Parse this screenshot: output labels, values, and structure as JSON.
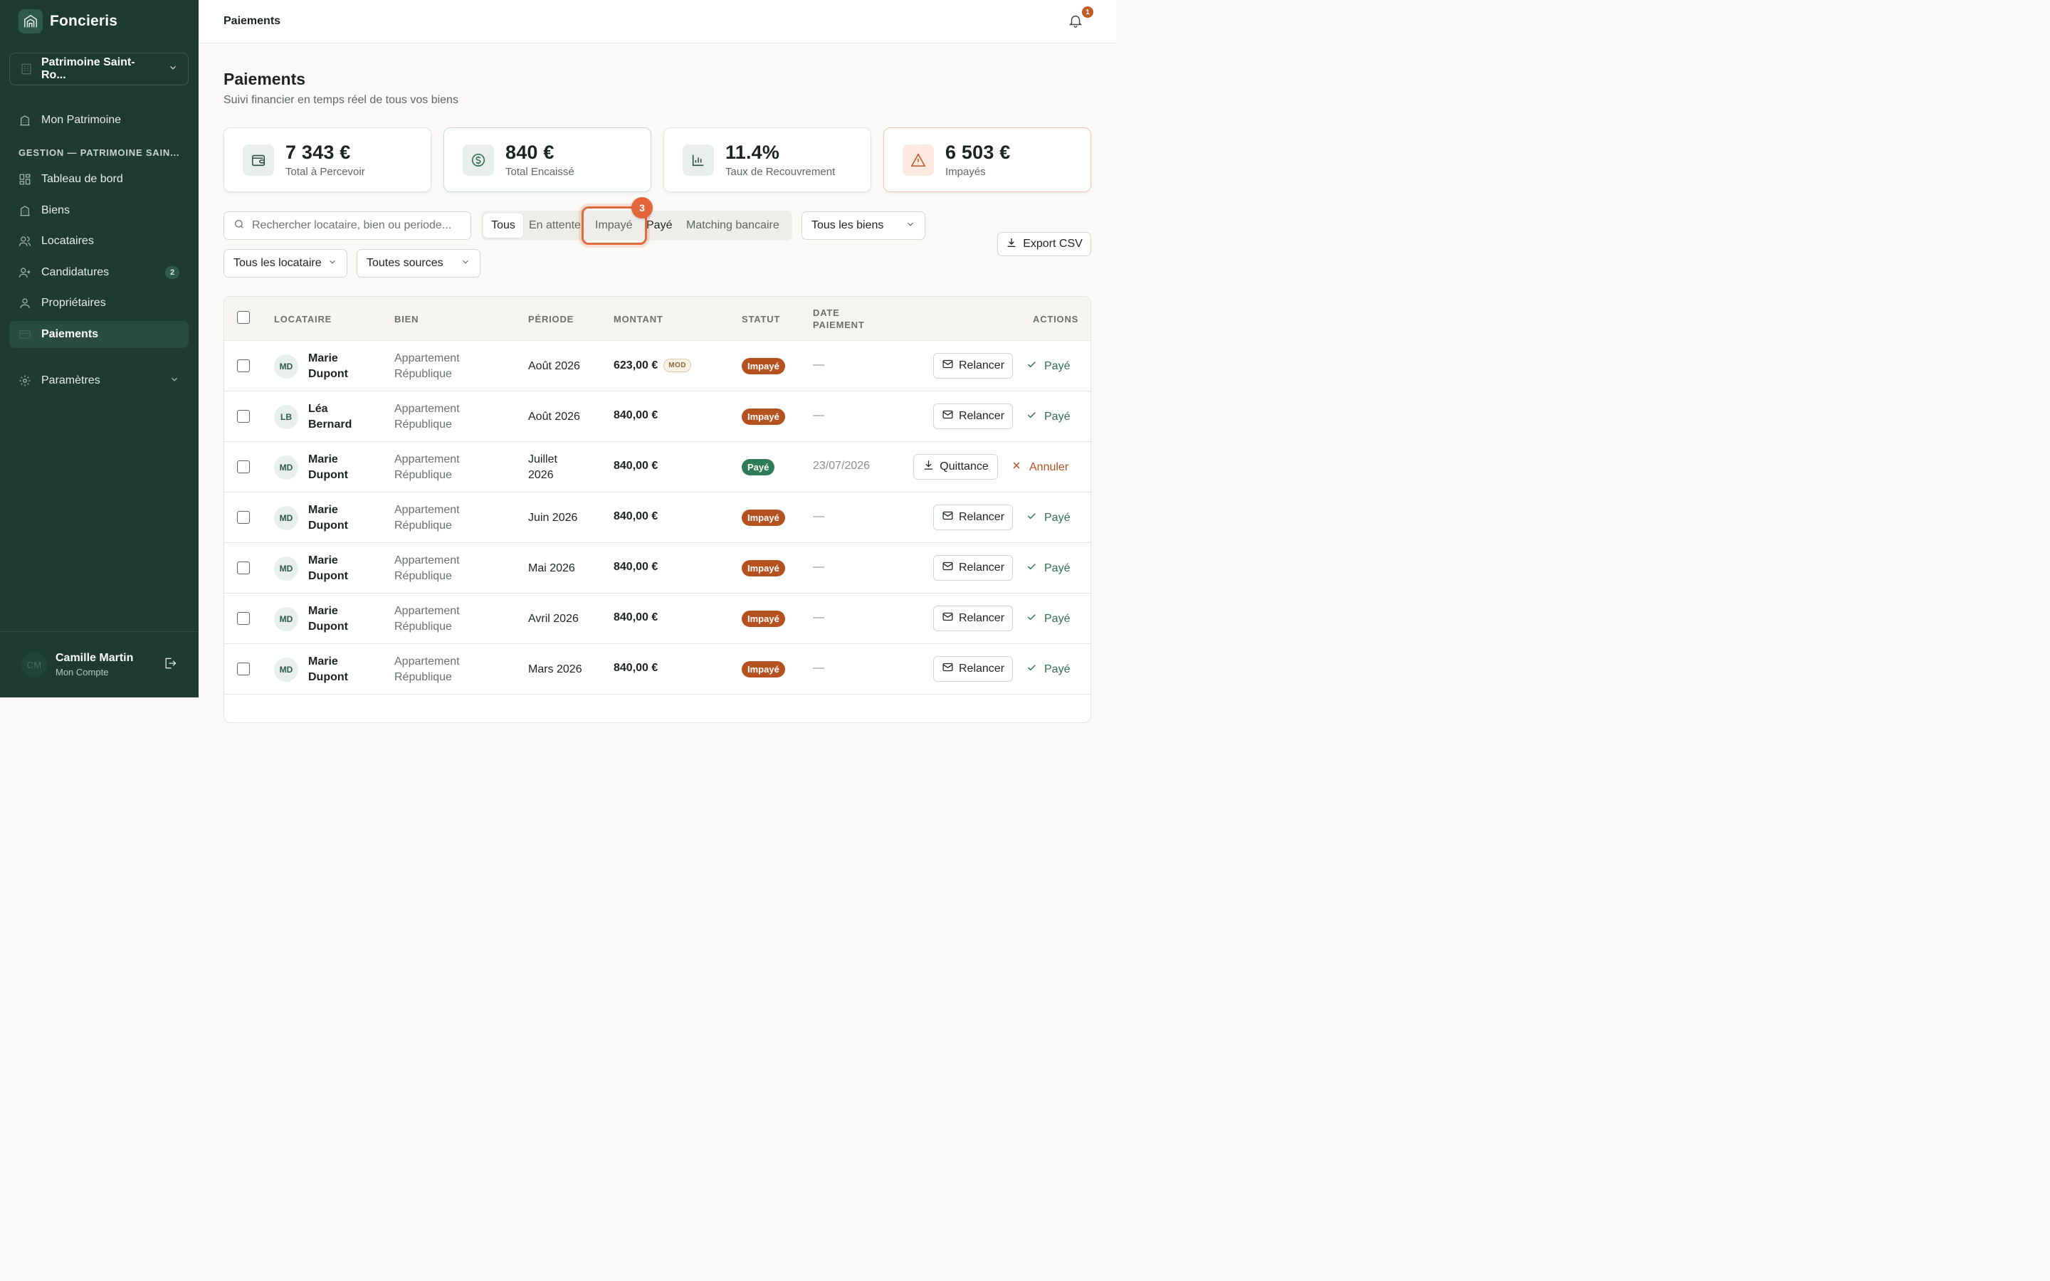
{
  "app": {
    "name": "Foncieris"
  },
  "org_select": {
    "label": "Patrimoine Saint-Ro..."
  },
  "nav": {
    "mon_patrimoine": "Mon Patrimoine",
    "section": "GESTION — PATRIMOINE SAIN...",
    "tableau": "Tableau de bord",
    "biens": "Biens",
    "locataires": "Locataires",
    "candidatures": "Candidatures",
    "candidatures_count": "2",
    "proprietaires": "Propriétaires",
    "paiements": "Paiements",
    "parametres": "Paramètres"
  },
  "user": {
    "initials": "CM",
    "name": "Camille Martin",
    "sub": "Mon Compte"
  },
  "topbar": {
    "title": "Paiements",
    "notif_count": "1"
  },
  "page": {
    "title": "Paiements",
    "subtitle": "Suivi financier en temps réel de tous vos biens"
  },
  "kpis": [
    {
      "value": "7 343 €",
      "label": "Total à Percevoir"
    },
    {
      "value": "840 €",
      "label": "Total Encaissé"
    },
    {
      "value": "11.4%",
      "label": "Taux de Recouvrement"
    },
    {
      "value": "6 503 €",
      "label": "Impayés"
    }
  ],
  "filters": {
    "search_placeholder": "Rechercher locataire, bien ou periode...",
    "tabs": [
      "Tous",
      "En attente",
      "Impayé",
      "Payé",
      "Matching bancaire"
    ],
    "step_badge": "3",
    "biens": "Tous les biens",
    "locataires": "Tous les locataires",
    "sources": "Toutes sources",
    "export": "Export CSV"
  },
  "table": {
    "headers": {
      "locataire": "LOCATAIRE",
      "bien": "BIEN",
      "periode": "PÉRIODE",
      "montant": "MONTANT",
      "statut": "STATUT",
      "date_1": "DATE",
      "date_2": "PAIEMENT",
      "actions": "ACTIONS"
    },
    "rows": [
      {
        "initials": "MD",
        "first": "Marie",
        "last": "Dupont",
        "bien1": "Appartement",
        "bien2": "République",
        "period1": "Août 2026",
        "period2": "",
        "amount": "623,00 €",
        "mod": "MOD",
        "status": "Impayé",
        "date": "—",
        "action": "Relancer",
        "link": "Payé"
      },
      {
        "initials": "LB",
        "first": "Léa",
        "last": "Bernard",
        "bien1": "Appartement",
        "bien2": "République",
        "period1": "Août 2026",
        "period2": "",
        "amount": "840,00 €",
        "mod": "",
        "status": "Impayé",
        "date": "—",
        "action": "Relancer",
        "link": "Payé"
      },
      {
        "initials": "MD",
        "first": "Marie",
        "last": "Dupont",
        "bien1": "Appartement",
        "bien2": "République",
        "period1": "Juillet",
        "period2": "2026",
        "amount": "840,00 €",
        "mod": "",
        "status": "Payé",
        "date": "23/07/2026",
        "action": "Quittance",
        "link": "Annuler"
      },
      {
        "initials": "MD",
        "first": "Marie",
        "last": "Dupont",
        "bien1": "Appartement",
        "bien2": "République",
        "period1": "Juin 2026",
        "period2": "",
        "amount": "840,00 €",
        "mod": "",
        "status": "Impayé",
        "date": "—",
        "action": "Relancer",
        "link": "Payé"
      },
      {
        "initials": "MD",
        "first": "Marie",
        "last": "Dupont",
        "bien1": "Appartement",
        "bien2": "République",
        "period1": "Mai 2026",
        "period2": "",
        "amount": "840,00 €",
        "mod": "",
        "status": "Impayé",
        "date": "—",
        "action": "Relancer",
        "link": "Payé"
      },
      {
        "initials": "MD",
        "first": "Marie",
        "last": "Dupont",
        "bien1": "Appartement",
        "bien2": "République",
        "period1": "Avril 2026",
        "period2": "",
        "amount": "840,00 €",
        "mod": "",
        "status": "Impayé",
        "date": "—",
        "action": "Relancer",
        "link": "Payé"
      },
      {
        "initials": "MD",
        "first": "Marie",
        "last": "Dupont",
        "bien1": "Appartement",
        "bien2": "République",
        "period1": "Mars 2026",
        "period2": "",
        "amount": "840,00 €",
        "mod": "",
        "status": "Impayé",
        "date": "—",
        "action": "Relancer",
        "link": "Payé"
      }
    ]
  },
  "colors": {
    "sidebar": "#1d3b31",
    "accent": "#2f6e52",
    "unpaid": "#b5501f",
    "paid": "#2f7a57",
    "highlight": "#e06a3a"
  },
  "icons": [
    "building-icon",
    "chevron-down-icon",
    "grid-icon",
    "users-icon",
    "user-plus-icon",
    "user-icon",
    "card-icon",
    "gear-icon",
    "logout-icon",
    "bell-icon",
    "wallet-icon",
    "dollar-icon",
    "bar-chart-icon",
    "alert-icon",
    "search-icon",
    "download-icon",
    "mail-icon",
    "check-icon",
    "x-icon"
  ]
}
